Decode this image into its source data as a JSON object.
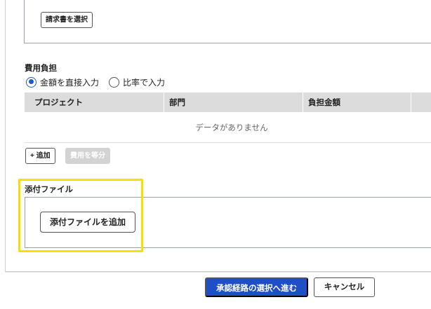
{
  "invoice": {
    "select_label": "請求書を選択"
  },
  "cost_sharing": {
    "title": "費用負担",
    "options": [
      {
        "label": "金額を直接入力",
        "selected": true
      },
      {
        "label": "比率で入力",
        "selected": false
      }
    ],
    "columns": [
      "プロジェクト",
      "部門",
      "負担金額"
    ],
    "empty_text": "データがありません",
    "add_label": "+ 追加",
    "split_label": "費用を等分"
  },
  "attachments": {
    "title": "添付ファイル",
    "add_label": "添付ファイルを追加"
  },
  "footer": {
    "proceed_label": "承認経路の選択へ進む",
    "cancel_label": "キャンセル"
  },
  "colors": {
    "primary": "#1f4fc6",
    "highlight": "#f5e000",
    "table_header": "#dcdcdc"
  }
}
